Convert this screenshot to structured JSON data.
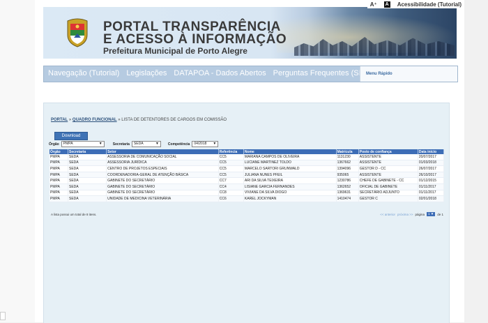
{
  "topbar": {
    "font_size": "A⁺",
    "access_icon": "A",
    "accessibility": "Acessibilidade (Tutorial)"
  },
  "header": {
    "title_line1": "PORTAL TRANSPARÊNCIA",
    "title_line2": "E ACESSO À INFORMAÇÃO",
    "subtitle": "Prefeitura Municipal de Porto Alegre",
    "crest_icon": "city-coat-of-arms"
  },
  "nav": {
    "items": [
      "Navegação (Tutorial)",
      "Legislações",
      "DATAPOA - Dados Abertos",
      "Perguntas Frequentes (SIC)"
    ],
    "quick_menu": "Menu Rápido"
  },
  "breadcrumb": {
    "portal": "PORTAL",
    "sep1": "»",
    "section": "QUADRO FUNCIONAL",
    "sep2": "»",
    "page": "LISTA DE DETENTORES DE CARGOS EM COMISSÃO"
  },
  "download_label": "Download",
  "filters": {
    "orgao_label": "Órgão",
    "orgao_value": "PMPA",
    "secretaria_label": "Secretaria",
    "secretaria_value": "SEDA",
    "competencia_label": "Competência",
    "competencia_value": "04/2018"
  },
  "table": {
    "headers": [
      "Órgão",
      "Secretaria",
      "Setor",
      "Referência",
      "Nome",
      "Matrícula",
      "Posto de confiança",
      "Data início"
    ],
    "rows": [
      [
        "PMPA",
        "SEDA",
        "ASSESSORIA DE COMUNICAÇÃO SOCIAL",
        "CC5",
        "MARIANA CAMPOS DE OLIVEIRA",
        "1131230",
        "ASSISTENTE",
        "20/07/2017"
      ],
      [
        "PMPA",
        "SEDA",
        "ASSESSORIA JURÍDICA",
        "CC5",
        "LUCIANE MARTINEZ TOLDO",
        "1367662",
        "ASSISTENTE",
        "01/03/2018"
      ],
      [
        "PMPA",
        "SEDA",
        "CENTRO DE PROJETOS ESPECIAIS",
        "CC5",
        "MARCELO SARTORI GRUNWALD",
        "1394096",
        "GESTOR D - CC",
        "26/07/2017"
      ],
      [
        "PMPA",
        "SEDA",
        "COORDENADORIA-GERAL DE ATENÇÃO BÁSICA",
        "CC5",
        "JULIANA NUNES PFEIL",
        "935065",
        "ASSISTENTE",
        "26/10/2017"
      ],
      [
        "PMPA",
        "SEDA",
        "GABINETE DO SECRETÁRIO",
        "CC7",
        "ARI DA SILVA TEIXEIRA",
        "1230786",
        "CHEFE DE GABINETE - CC",
        "01/12/2015"
      ],
      [
        "PMPA",
        "SEDA",
        "GABINETE DO SECRETÁRIO",
        "CC4",
        "LISIANE GARCIA FERNANDES",
        "1362652",
        "OFICIAL DE GABINETE",
        "01/11/2017"
      ],
      [
        "PMPA",
        "SEDA",
        "GABINETE DO SECRETÁRIO",
        "CC8",
        "VIVIANE DA SILVA DIOGO",
        "1369631",
        "SECRETÁRIO ADJUNTO",
        "01/11/2017"
      ],
      [
        "PMPA",
        "SEDA",
        "UNIDADE DE MEDICINA VETERINÁRIA",
        "CC6",
        "KAREL JOCKYMAN",
        "1410474",
        "GESTOR C",
        "02/01/2018"
      ]
    ]
  },
  "footer": {
    "count_text": "A lista possui um total de 8 itens.",
    "prev": "<< anterior",
    "next": "próxima >>",
    "page_label": "página",
    "page_value": "1",
    "of_label": "de 1"
  }
}
